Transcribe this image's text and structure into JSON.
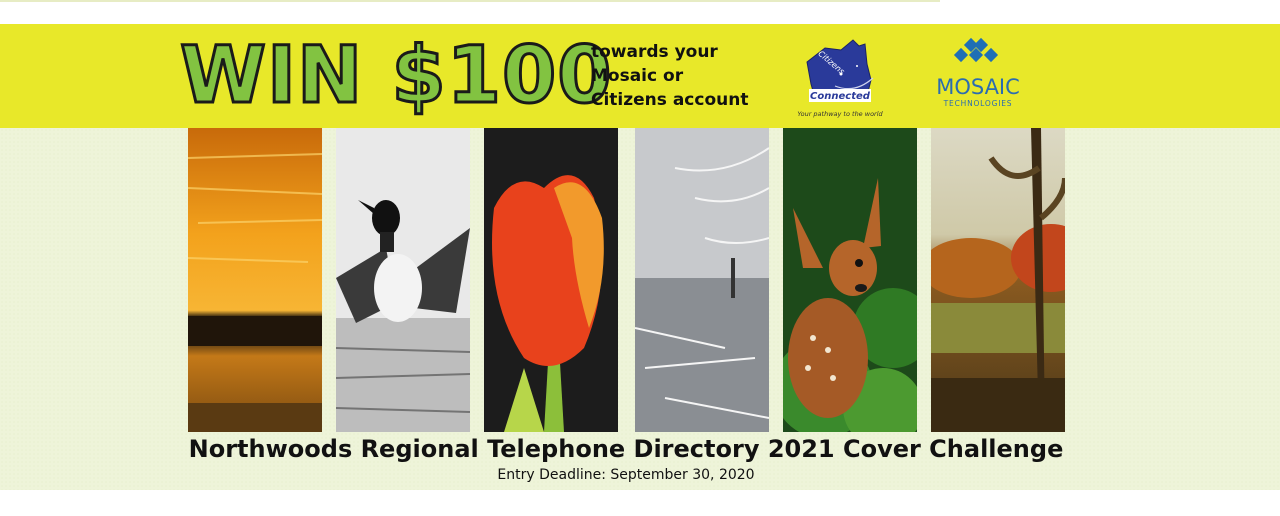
{
  "promo": {
    "headline": "WIN $100",
    "subtext": [
      "towards your",
      "Mosaic or",
      "Citizens account"
    ]
  },
  "logos": {
    "citizens": {
      "word1": "Citizens",
      "word2": "Connected",
      "tagline": "Your pathway to the world"
    },
    "mosaic": {
      "name": "MOSAIC",
      "sub": "TECHNOLOGIES"
    }
  },
  "photos": [
    {
      "name": "sunset-lake-photo"
    },
    {
      "name": "loon-photo"
    },
    {
      "name": "tulip-photo"
    },
    {
      "name": "winter-river-photo"
    },
    {
      "name": "fawn-photo"
    },
    {
      "name": "autumn-cornfield-photo"
    }
  ],
  "contest": {
    "title": "Northwoods Regional Telephone Directory 2021 Cover Challenge",
    "deadline": "Entry Deadline: September 30, 2020"
  },
  "colors": {
    "banner": "#e8e829",
    "headline_fill": "#82c341",
    "background": "#eef4d9",
    "mosaic_blue": "#1f6fb5"
  }
}
